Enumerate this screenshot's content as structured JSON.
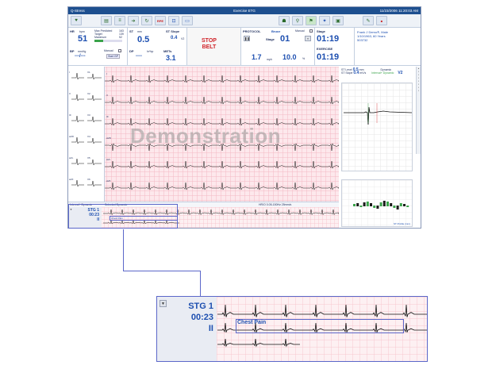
{
  "titlebar": {
    "app": "Q-Stress",
    "title": "Exercise ETG",
    "datetime": "11/23/2006 11:20:03 AM"
  },
  "vitals": {
    "hr": {
      "label": "HR",
      "unit": "bpm",
      "value": "51",
      "max_label": "Max Predicted",
      "max_value": "163",
      "target_label": "Target",
      "target_value": "139",
      "maximum_label": "Maximum",
      "maximum_value": "52",
      "bar_pct": "31%"
    },
    "bp": {
      "label": "BP",
      "unit": "mmHg",
      "value": "---/---",
      "manual_label": "Manual",
      "start_label": "Start BP"
    },
    "st": {
      "label": "ST",
      "unit": "mm",
      "value": "0.5",
      "slope_label": "ST Slope",
      "slope_value": "0.4",
      "lead": "V2"
    },
    "dp": {
      "label": "DP",
      "unit": "hr*bp",
      "value": "----",
      "mets_label": "METs",
      "mets_value": "3.1"
    },
    "stop": {
      "line1": "STOP",
      "line2": "BELT"
    },
    "protocol": {
      "label": "PROTOCOL",
      "name": "Bruce",
      "manual": "Manual",
      "stage_label": "Stage",
      "stage_value": "01",
      "speed": "1.7",
      "speed_unit": "mph",
      "grade": "10.0",
      "grade_unit": "%"
    },
    "stage_time": {
      "label": "Stage",
      "value": "01:19",
      "ex_label": "EXERCISE",
      "ex_value": "01:19"
    },
    "patient": {
      "name": "Frank J Demo®, Male",
      "dob": "1/10/1963, 60 Years",
      "id": "503732"
    }
  },
  "leads": [
    "I",
    "II",
    "III",
    "aVR",
    "aVL",
    "aVF",
    "V1",
    "V2",
    "V3",
    "V4",
    "V5",
    "V6"
  ],
  "watermark": "Demonstration",
  "ecg_footer": {
    "left": "Interval+  Dynamic",
    "mid": "Selected  Dynamic",
    "right": "HR/O   0.05-150Hz   25mm/s"
  },
  "st_panel": {
    "level_label": "ST Level",
    "level_value": "0.5",
    "level_unit": "mm",
    "slope_label": "ST Slope",
    "slope_value": "0.4",
    "slope_unit": "mV/s",
    "lead": "V2",
    "mode": "Dynamic",
    "sub": "Interval+ Dynamic",
    "footer": "ST Profile (mm)"
  },
  "strip": {
    "stage": "STG 1",
    "time": "00:23",
    "lead": "II",
    "event": "Chest Pain"
  },
  "zoom": {
    "stage": "STG 1",
    "time": "00:23",
    "lead": "II",
    "event": "Chest Pain",
    "dropdown": "▼"
  }
}
